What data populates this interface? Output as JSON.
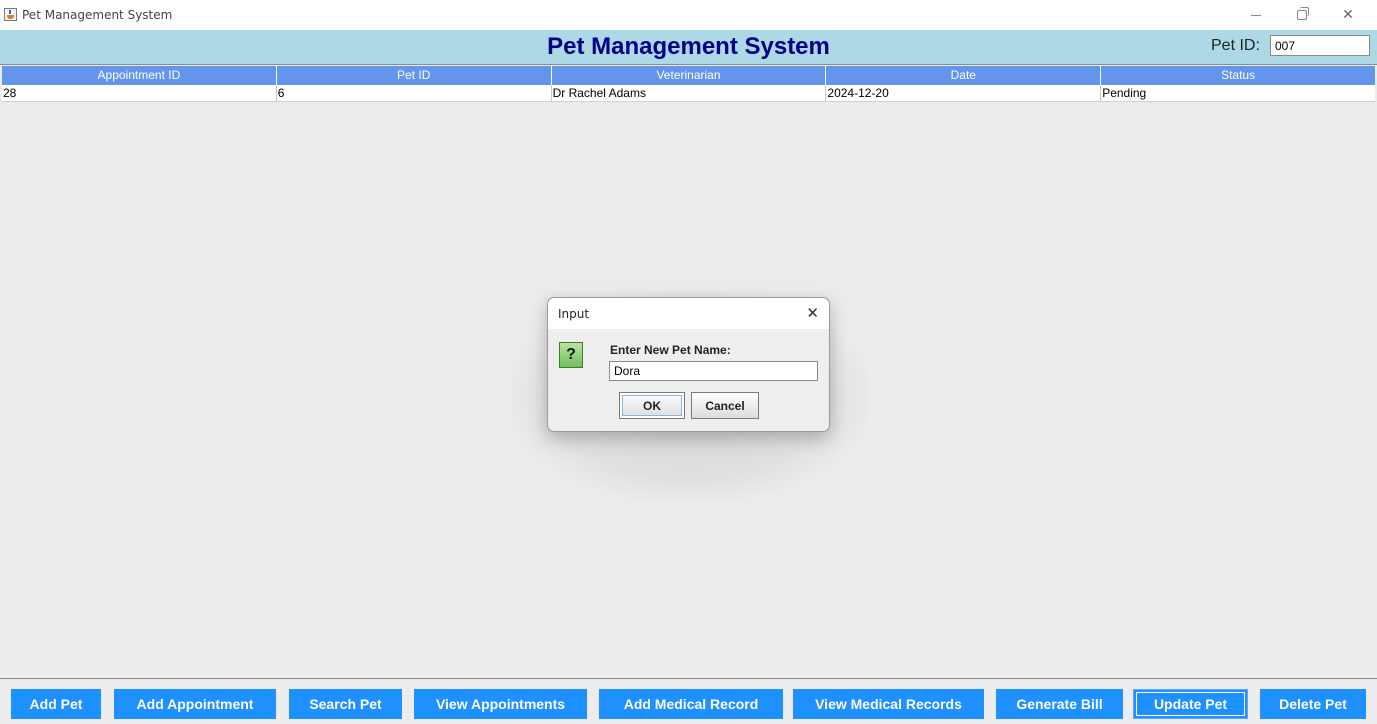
{
  "window": {
    "title": "Pet Management System",
    "controls": {
      "minimize": "minimize",
      "maximize": "maximize",
      "close": "close"
    }
  },
  "header": {
    "title": "Pet Management System",
    "pet_id_label": "Pet ID:",
    "pet_id_value": "007"
  },
  "table": {
    "columns": [
      "Appointment ID",
      "Pet ID",
      "Veterinarian",
      "Date",
      "Status"
    ],
    "rows": [
      [
        "28",
        "6",
        "Dr Rachel Adams",
        "2024-12-20",
        "Pending"
      ]
    ]
  },
  "dialog": {
    "title": "Input",
    "icon": "question-icon",
    "icon_glyph": "?",
    "prompt": "Enter New Pet Name:",
    "input_value": "Dora",
    "ok_label": "OK",
    "cancel_label": "Cancel",
    "close_glyph": "✕"
  },
  "actions": {
    "add_pet": "Add Pet",
    "add_appointment": "Add Appointment",
    "search_pet": "Search Pet",
    "view_appointments": "View Appointments",
    "add_medical_record": "Add Medical Record",
    "view_medical_records": "View Medical Records",
    "generate_bill": "Generate Bill",
    "update_pet": "Update Pet",
    "delete_pet": "Delete Pet"
  },
  "colors": {
    "header_bg": "#add8e6",
    "title_color": "#00008b",
    "table_header_bg": "#6495ed",
    "button_bg": "#1e90ff"
  }
}
